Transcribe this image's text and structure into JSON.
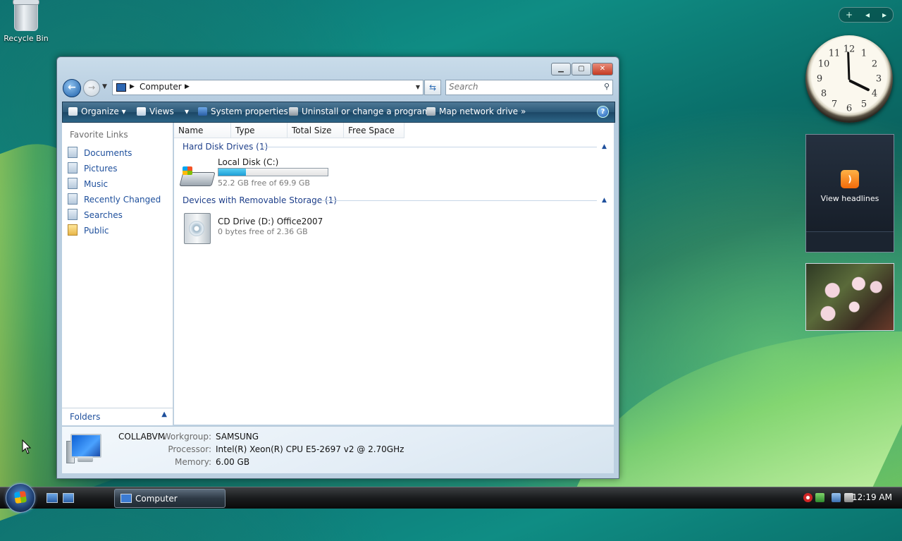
{
  "desktop": {
    "recycle_bin_label": "Recycle Bin"
  },
  "sidebar": {
    "controls": [
      "+",
      "◂",
      "▸"
    ],
    "clock": {
      "numbers": [
        "12",
        "1",
        "2",
        "3",
        "4",
        "5",
        "6",
        "7",
        "8",
        "9",
        "10",
        "11"
      ]
    },
    "headlines": {
      "label": "View headlines",
      "icon": "rss-icon"
    }
  },
  "window": {
    "title_buttons": [
      "minimize",
      "maximize",
      "close"
    ],
    "address": {
      "crumb": "Computer",
      "search_placeholder": "Search"
    },
    "toolbar": {
      "organize": "Organize",
      "views": "Views",
      "system_properties": "System properties",
      "uninstall": "Uninstall or change a program",
      "map_network": "Map network drive",
      "more": "»"
    },
    "nav": {
      "title": "Favorite Links",
      "links": [
        "Documents",
        "Pictures",
        "Music",
        "Recently Changed",
        "Searches",
        "Public"
      ],
      "folders_label": "Folders"
    },
    "columns": [
      "Name",
      "Type",
      "Total Size",
      "Free Space"
    ],
    "groups": {
      "hdd": {
        "title": "Hard Disk Drives (1)",
        "drive_name": "Local Disk (C:)",
        "drive_free": "52.2 GB free of 69.9 GB",
        "used_fraction": 0.25
      },
      "removable": {
        "title": "Devices with Removable Storage (1)",
        "drive_name": "CD Drive (D:) Office2007",
        "drive_free": "0 bytes free of 2.36 GB"
      }
    },
    "details": {
      "computer_name": "COLLABVM",
      "workgroup_label": "Workgroup:",
      "workgroup": "SAMSUNG",
      "processor_label": "Processor:",
      "processor": "Intel(R) Xeon(R) CPU E5-2697 v2 @ 2.70GHz",
      "memory_label": "Memory:",
      "memory": "6.00 GB"
    }
  },
  "taskbar": {
    "task_label": "Computer",
    "time": "12:19 AM"
  }
}
